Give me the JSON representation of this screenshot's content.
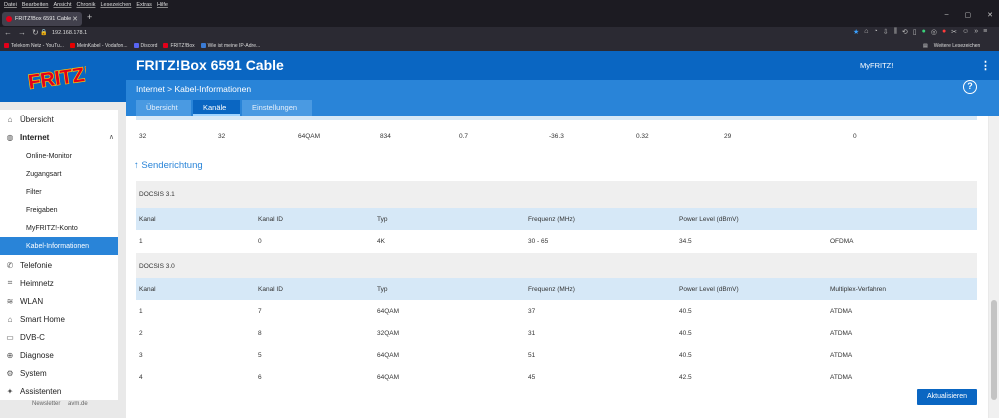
{
  "browser": {
    "menu": [
      "Datei",
      "Bearbeiten",
      "Ansicht",
      "Chronik",
      "Lesezeichen",
      "Extras",
      "Hilfe"
    ],
    "tab_title": "FRITZ!Box 6591 Cable",
    "url": "192.168.178.1",
    "bookmarks": [
      {
        "label": "Telekom Netz - YouTu...",
        "color": "#e2001a"
      },
      {
        "label": "MeinKabel - Vodafon...",
        "color": "#e60000"
      },
      {
        "label": "Discord",
        "color": "#5865f2"
      },
      {
        "label": "FRITZ!Box",
        "color": "#e2001a"
      },
      {
        "label": "Wie ist meine IP-Adre...",
        "color": "#3a7bd5"
      }
    ],
    "other_bookmarks": "Weitere Lesezeichen"
  },
  "header": {
    "title": "FRITZ!Box 6591 Cable",
    "myfritz": "MyFRITZ!",
    "breadcrumb": "Internet > Kabel-Informationen",
    "help": "?"
  },
  "tabs": [
    "Übersicht",
    "Kanäle",
    "Einstellungen"
  ],
  "sidebar": {
    "items": [
      {
        "label": "Übersicht",
        "icon": "home-icon",
        "glyph": "⌂",
        "type": "main"
      },
      {
        "label": "Internet",
        "icon": "globe-icon",
        "glyph": "◍",
        "type": "main-open"
      },
      {
        "label": "Online-Monitor",
        "type": "sub"
      },
      {
        "label": "Zugangsart",
        "type": "sub"
      },
      {
        "label": "Filter",
        "type": "sub"
      },
      {
        "label": "Freigaben",
        "type": "sub"
      },
      {
        "label": "MyFRITZ!-Konto",
        "type": "sub"
      },
      {
        "label": "Kabel-Informationen",
        "type": "sub-selected"
      },
      {
        "label": "Telefonie",
        "icon": "phone-icon",
        "glyph": "✆",
        "type": "main"
      },
      {
        "label": "Heimnetz",
        "icon": "network-icon",
        "glyph": "⌗",
        "type": "main"
      },
      {
        "label": "WLAN",
        "icon": "wifi-icon",
        "glyph": "≋",
        "type": "main"
      },
      {
        "label": "Smart Home",
        "icon": "smarthome-icon",
        "glyph": "⌂",
        "type": "main"
      },
      {
        "label": "DVB-C",
        "icon": "tv-icon",
        "glyph": "▭",
        "type": "main"
      },
      {
        "label": "Diagnose",
        "icon": "diagnose-icon",
        "glyph": "⊕",
        "type": "main"
      },
      {
        "label": "System",
        "icon": "system-icon",
        "glyph": "⚙",
        "type": "main"
      },
      {
        "label": "Assistenten",
        "icon": "wizard-icon",
        "glyph": "✦",
        "type": "main"
      }
    ],
    "footer": [
      "Newsletter",
      "avm.de"
    ]
  },
  "top_row": [
    "32",
    "32",
    "64QAM",
    "834",
    "0.7",
    "-36.3",
    "0.32",
    "29",
    "0"
  ],
  "section_title": "↑ Senderichtung",
  "docsis31": {
    "label": "DOCSIS 3.1",
    "headers": [
      "Kanal",
      "Kanal ID",
      "Typ",
      "Frequenz (MHz)",
      "Power Level (dBmV)",
      ""
    ],
    "rows": [
      [
        "1",
        "0",
        "4K",
        "30 - 65",
        "34.5",
        "OFDMA"
      ]
    ]
  },
  "docsis30": {
    "label": "DOCSIS 3.0",
    "headers": [
      "Kanal",
      "Kanal ID",
      "Typ",
      "Frequenz (MHz)",
      "Power Level (dBmV)",
      "Multiplex-Verfahren"
    ],
    "rows": [
      [
        "1",
        "7",
        "64QAM",
        "37",
        "40.5",
        "ATDMA"
      ],
      [
        "2",
        "8",
        "32QAM",
        "31",
        "40.5",
        "ATDMA"
      ],
      [
        "3",
        "5",
        "64QAM",
        "51",
        "40.5",
        "ATDMA"
      ],
      [
        "4",
        "6",
        "64QAM",
        "45",
        "42.5",
        "ATDMA"
      ]
    ]
  },
  "refresh_label": "Aktualisieren"
}
